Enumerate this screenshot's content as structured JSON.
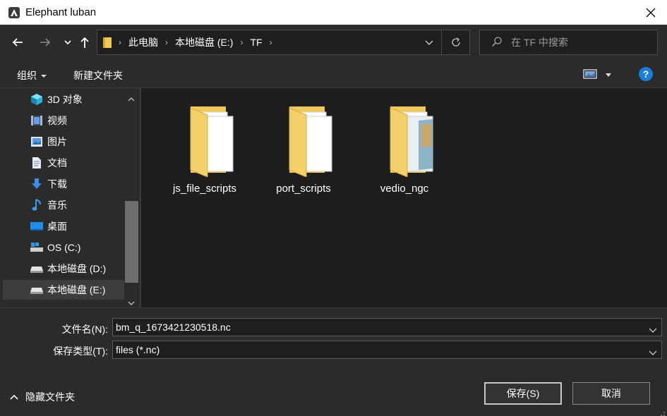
{
  "window": {
    "title": "Elephant luban"
  },
  "address": {
    "crumbs": [
      "此电脑",
      "本地磁盘 (E:)",
      "TF"
    ]
  },
  "search": {
    "placeholder": "在 TF 中搜索"
  },
  "commands": {
    "organize": "组织",
    "new_folder": "新建文件夹",
    "help": "?"
  },
  "nav": {
    "items": [
      {
        "label": "3D 对象",
        "icon": "cube-3d-icon"
      },
      {
        "label": "视频",
        "icon": "video-icon"
      },
      {
        "label": "图片",
        "icon": "picture-icon"
      },
      {
        "label": "文档",
        "icon": "document-icon"
      },
      {
        "label": "下载",
        "icon": "download-icon"
      },
      {
        "label": "音乐",
        "icon": "music-icon"
      },
      {
        "label": "桌面",
        "icon": "desktop-icon"
      },
      {
        "label": "OS (C:)",
        "icon": "os-drive-icon"
      },
      {
        "label": "本地磁盘 (D:)",
        "icon": "drive-icon"
      },
      {
        "label": "本地磁盘 (E:)",
        "icon": "drive-icon",
        "selected": true
      }
    ]
  },
  "folders": [
    {
      "name": "js_file_scripts"
    },
    {
      "name": "port_scripts"
    },
    {
      "name": "vedio_ngc"
    }
  ],
  "filename": {
    "label": "文件名(N):",
    "value": "bm_q_1673421230518.nc"
  },
  "filetype": {
    "label": "保存类型(T):",
    "value": "files (*.nc)"
  },
  "hide_folders": "隐藏文件夹",
  "buttons": {
    "save": "保存(S)",
    "cancel": "取消"
  },
  "colors": {
    "accent": "#1a7fd9",
    "folder": "#f0c95a",
    "background": "#2b2b2b",
    "content_bg": "#1e1e1e"
  }
}
